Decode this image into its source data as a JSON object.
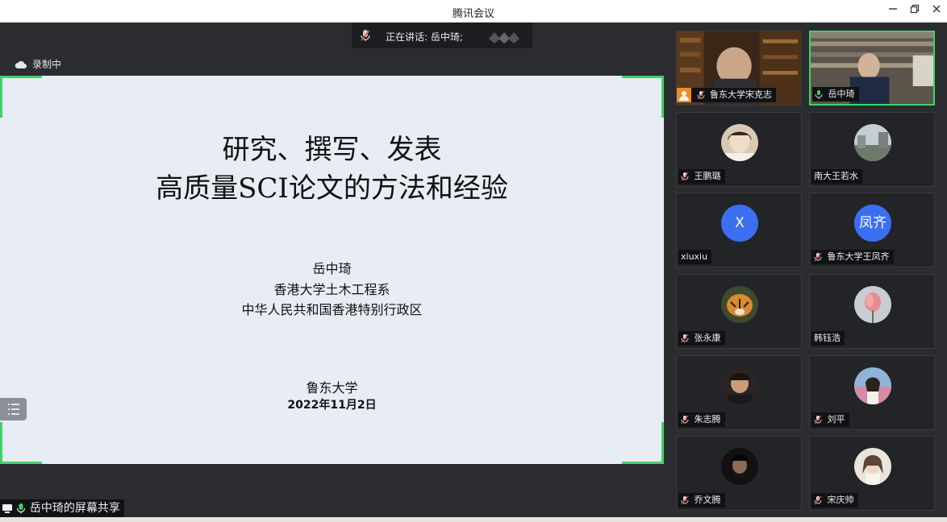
{
  "window": {
    "title": "腾讯会议"
  },
  "speaking": {
    "text": "正在讲话: 岳中琦;"
  },
  "recording": {
    "label": "录制中"
  },
  "slide": {
    "title_line1": "研究、撰写、发表",
    "title_line2": "高质量SCI论文的方法和经验",
    "author": "岳中琦",
    "affiliation": "香港大学土木工程系",
    "region": "中华人民共和国香港特别行政区",
    "venue": "鲁东大学",
    "date": "2022年11月2日"
  },
  "screen_share": {
    "label": "岳中琦的屏幕共享"
  },
  "participants": [
    {
      "name": "鲁东大学宋克志",
      "type": "video",
      "mic": "muted",
      "host_badge": true
    },
    {
      "name": "岳中琦",
      "type": "video",
      "mic": "on",
      "active": true
    },
    {
      "name": "王鹏璐",
      "type": "photo",
      "mic": "muted"
    },
    {
      "name": "南大王若水",
      "type": "photo",
      "mic": "none"
    },
    {
      "name": "xiuxiu",
      "type": "letter",
      "letter": "X",
      "mic": "none"
    },
    {
      "name": "鲁东大学王凤齐",
      "type": "letter",
      "letter": "凤齐",
      "mic": "muted"
    },
    {
      "name": "张永康",
      "type": "photo",
      "mic": "muted"
    },
    {
      "name": "韩钰浩",
      "type": "photo",
      "mic": "none"
    },
    {
      "name": "朱志腾",
      "type": "photo",
      "mic": "muted"
    },
    {
      "name": "刘平",
      "type": "photo",
      "mic": "muted"
    },
    {
      "name": "乔文腾",
      "type": "photo",
      "mic": "muted"
    },
    {
      "name": "宋庆帅",
      "type": "photo",
      "mic": "muted"
    }
  ],
  "colors": {
    "accent_green": "#3fd16a",
    "avatar_blue": "#3b6ff2",
    "mic_muted_red": "#e5484d"
  }
}
